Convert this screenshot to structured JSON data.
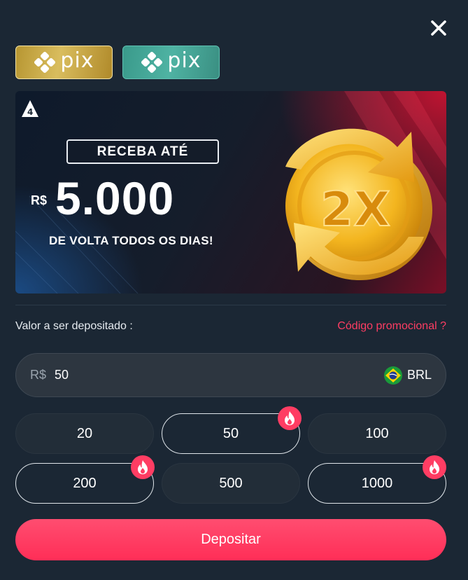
{
  "close": {
    "icon": "close-icon"
  },
  "payment_tabs": [
    {
      "label": "pix",
      "style": "gold",
      "icon": "pix-logo-icon"
    },
    {
      "label": "pix",
      "style": "teal",
      "icon": "pix-logo-icon"
    }
  ],
  "banner": {
    "headline": "RECEBA ATÉ",
    "currency": "R$",
    "amount": "5.000",
    "subline": "DE VOLTA TODOS OS DIAS!",
    "coin_text": "2X",
    "brand_icon": "brand-logo-icon"
  },
  "deposit": {
    "label": "Valor a ser depositado :",
    "promo_link": "Código promocional ?",
    "currency_prefix": "R$",
    "amount_value": "50",
    "currency_code": "BRL",
    "flag_icon": "brazil-flag-icon"
  },
  "amount_options": [
    {
      "label": "20",
      "selected": false,
      "hot": false
    },
    {
      "label": "50",
      "selected": true,
      "hot": true
    },
    {
      "label": "100",
      "selected": false,
      "hot": false
    },
    {
      "label": "200",
      "selected": false,
      "hot": true
    },
    {
      "label": "500",
      "selected": false,
      "hot": false
    },
    {
      "label": "1000",
      "selected": false,
      "hot": true
    }
  ],
  "submit": {
    "label": "Depositar"
  },
  "colors": {
    "background": "#1b2734",
    "accent": "#ff3d63",
    "gold": "#d9bd5e",
    "teal": "#4fb3a3"
  }
}
